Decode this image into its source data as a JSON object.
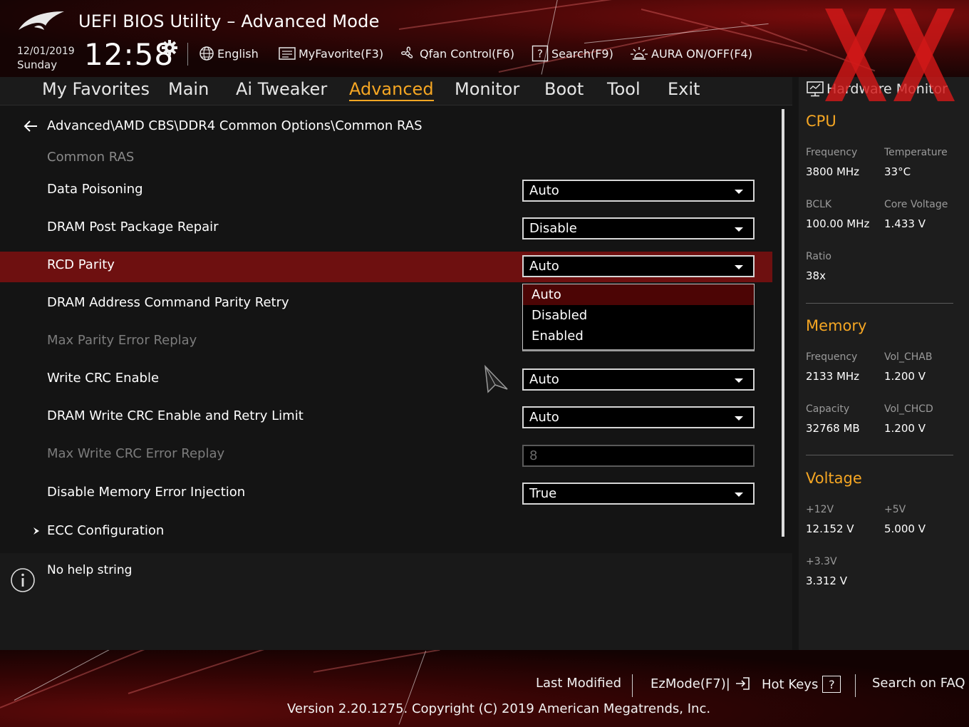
{
  "header": {
    "title": "UEFI BIOS Utility – Advanced Mode",
    "date": "12/01/2019",
    "day": "Sunday",
    "time": "12:58",
    "tools": [
      {
        "label": "English",
        "icon": "globe-icon"
      },
      {
        "label": "MyFavorite(F3)",
        "icon": "favorite-card-icon"
      },
      {
        "label": "Qfan Control(F6)",
        "icon": "fan-icon"
      },
      {
        "label": "Search(F9)",
        "icon": "search-question-icon"
      },
      {
        "label": "AURA ON/OFF(F4)",
        "icon": "aura-light-icon"
      }
    ]
  },
  "tabs": [
    "My Favorites",
    "Main",
    "Ai Tweaker",
    "Advanced",
    "Monitor",
    "Boot",
    "Tool",
    "Exit"
  ],
  "active_tab": "Advanced",
  "main": {
    "breadcrumb": "Advanced\\AMD CBS\\DDR4 Common Options\\Common RAS",
    "section_title": "Common RAS",
    "settings": [
      {
        "label": "Data Poisoning",
        "value": "Auto",
        "enabled": true
      },
      {
        "label": "DRAM Post Package Repair",
        "value": "Disable",
        "enabled": true
      },
      {
        "label": "RCD Parity",
        "value": "Auto",
        "enabled": true,
        "selected": true
      },
      {
        "label": "DRAM Address Command Parity Retry",
        "value": "",
        "enabled": true
      },
      {
        "label": "Max Parity Error Replay",
        "value": "",
        "enabled": false
      },
      {
        "label": "Write CRC Enable",
        "value": "Auto",
        "enabled": true
      },
      {
        "label": "DRAM Write CRC Enable and Retry Limit",
        "value": "Auto",
        "enabled": true
      },
      {
        "label": "Max Write CRC Error Replay",
        "value": "8",
        "enabled": false
      },
      {
        "label": "Disable Memory Error Injection",
        "value": "True",
        "enabled": true
      }
    ],
    "submenu": "ECC Configuration",
    "dropdown_options": [
      "Auto",
      "Disabled",
      "Enabled"
    ],
    "dropdown_selected": "Auto"
  },
  "help": {
    "text": "No help string"
  },
  "hardware_monitor": {
    "title": "Hardware Monitor",
    "cpu": {
      "heading": "CPU",
      "frequency_label": "Frequency",
      "frequency": "3800 MHz",
      "temperature_label": "Temperature",
      "temperature": "33°C",
      "bclk_label": "BCLK",
      "bclk": "100.00 MHz",
      "core_voltage_label": "Core Voltage",
      "core_voltage": "1.433 V",
      "ratio_label": "Ratio",
      "ratio": "38x"
    },
    "memory": {
      "heading": "Memory",
      "frequency_label": "Frequency",
      "frequency": "2133 MHz",
      "vol_chab_label": "Vol_CHAB",
      "vol_chab": "1.200 V",
      "capacity_label": "Capacity",
      "capacity": "32768 MB",
      "vol_chcd_label": "Vol_CHCD",
      "vol_chcd": "1.200 V"
    },
    "voltage": {
      "heading": "Voltage",
      "v12_label": "+12V",
      "v12": "12.152 V",
      "v5_label": "+5V",
      "v5": "5.000 V",
      "v33_label": "+3.3V",
      "v33": "3.312 V"
    }
  },
  "footer": {
    "last_modified": "Last Modified",
    "ezmode": "EzMode(F7)|",
    "hot_keys": "Hot Keys",
    "hot_keys_symbol": "?",
    "search_faq": "Search on FAQ",
    "version": "Version 2.20.1275. Copyright (C) 2019 American Megatrends, Inc."
  },
  "colors": {
    "accent": "#f5a623",
    "selected_row": "#6e1010",
    "dropdown_active": "#4c0505",
    "brand_red": "#c41a1a"
  }
}
